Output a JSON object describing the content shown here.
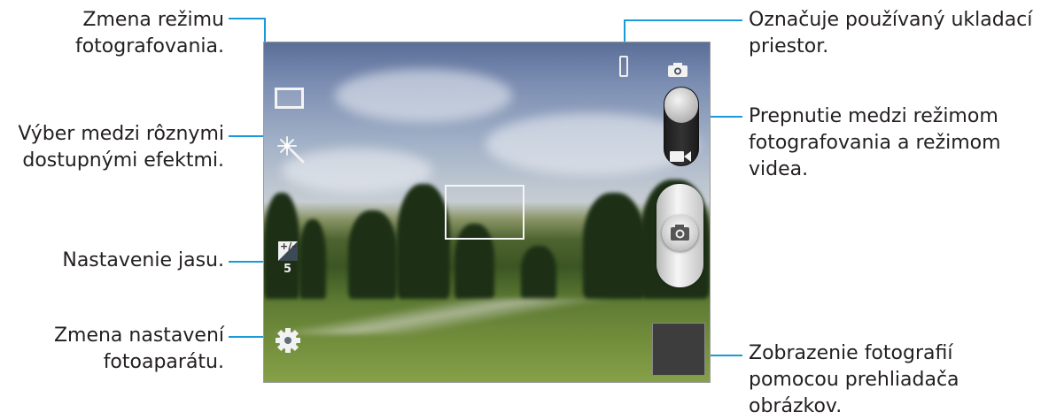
{
  "annotations": {
    "left": [
      {
        "name": "shooting-mode-label",
        "lines": [
          "Zmena režimu",
          "fotografovania."
        ]
      },
      {
        "name": "effects-label",
        "lines": [
          "Výber medzi rôznymi",
          "dostupnými efektmi."
        ]
      },
      {
        "name": "brightness-label",
        "lines": [
          "Nastavenie jasu."
        ]
      },
      {
        "name": "settings-label",
        "lines": [
          "Zmena nastavení",
          "fotoaparátu."
        ]
      }
    ],
    "right": [
      {
        "name": "storage-label",
        "lines": [
          "Označuje používaný ukladací",
          "priestor."
        ]
      },
      {
        "name": "photo-video-switch-label",
        "lines": [
          "Prepnutie medzi režimom",
          "fotografovania a režimom",
          "videa."
        ]
      },
      {
        "name": "image-viewer-label",
        "lines": [
          "Zobrazenie fotografií",
          "pomocou prehliadača",
          "obrázkov."
        ]
      }
    ]
  },
  "camera": {
    "brightness_value": "5",
    "brightness_symbol": "+/–",
    "icons": {
      "shooting_mode": "rectangle-frame-icon",
      "effects": "magic-wand-sparkle-icon",
      "brightness": "exposure-icon",
      "settings": "gear-icon",
      "storage": "phone-storage-icon",
      "camera_mode": "camera-icon",
      "video_mode": "video-camera-icon",
      "shutter": "camera-shutter-icon"
    }
  },
  "colors": {
    "leader": "#1a9ad6",
    "text": "#231f20"
  }
}
